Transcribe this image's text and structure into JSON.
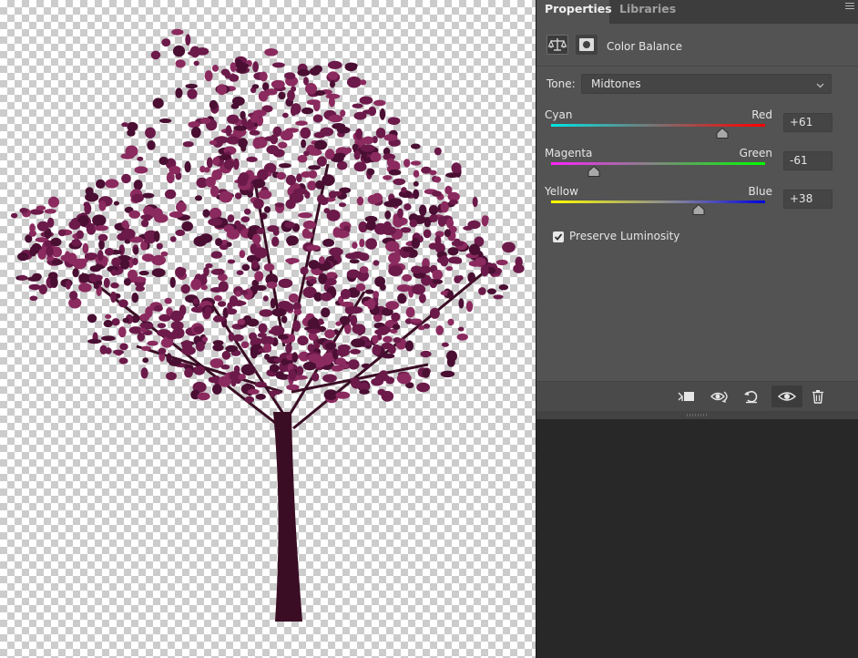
{
  "tabs": [
    {
      "label": "Properties",
      "active": true
    },
    {
      "label": "Libraries",
      "active": false
    }
  ],
  "adjustment": {
    "title": "Color Balance",
    "icon_primary": "color-balance-scales-icon",
    "icon_secondary": "layer-mask-icon"
  },
  "tone": {
    "label": "Tone:",
    "value": "Midtones"
  },
  "sliders": [
    {
      "left_label": "Cyan",
      "right_label": "Red",
      "value": "+61",
      "position": 0.8
    },
    {
      "left_label": "Magenta",
      "right_label": "Green",
      "value": "-61",
      "position": 0.2
    },
    {
      "left_label": "Yellow",
      "right_label": "Blue",
      "value": "+38",
      "position": 0.69
    }
  ],
  "preserve_luminosity": {
    "label": "Preserve Luminosity",
    "checked": true
  },
  "footer_icons": [
    "clip-to-layer-icon",
    "view-previous-state-icon",
    "reset-icon",
    "visibility-eye-icon",
    "trash-icon"
  ],
  "colors": {
    "canvas_checker_light": "#ffffff",
    "canvas_checker_dark": "#cccccc",
    "panel_bg": "#535353",
    "workspace_bg": "#282828",
    "tree_foliage": "#6b1a4a",
    "tree_trunk": "#3a0d24"
  }
}
